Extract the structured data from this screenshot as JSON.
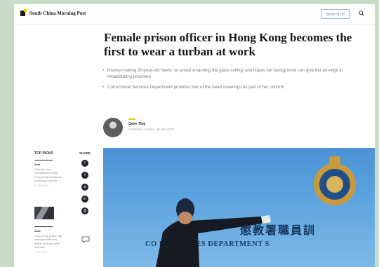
{
  "header": {
    "logo_text": "South China Morning Post",
    "signin_label": "SIGN IN UP",
    "search_icon": "search-icon"
  },
  "article": {
    "headline": "Female prison officer in Hong Kong becomes the first to wear a turban at work",
    "bullets": [
      "History-making 20-year-old Neels ‘so proud smashing the glass ceiling’ and hopes her background can give her an edge in rehabilitating prisoners",
      "Correctional Services Department provides four of the head coverings as part of her uniform"
    ],
    "author_name": "Gene Ting",
    "author_meta": "Published: 2:45am, 30 Mar 2019"
  },
  "sidebar": {
    "top_picks_title": "TOP PICKS",
    "picks": [
      {
        "tag": "Asia",
        "text": "Chinese man cannibalism during Hong Kong Christmas shopping customs",
        "time": "22 Jan 2019"
      },
      {
        "tag": "Asia",
        "text": "Hong Kong police say several rental and hotels as three were arrested",
        "time": "2 Mar 2019"
      }
    ]
  },
  "share": {
    "title": "SHARE",
    "buttons": [
      "f",
      "t",
      "w",
      "in",
      "@"
    ]
  },
  "photo": {
    "wall_chinese": "懲教署職員訓",
    "wall_english": "CO     L SERVICES DEPARTMENT S"
  },
  "colors": {
    "background": "#c9dcc8",
    "accent": "#f3c200",
    "link": "#6f86a8",
    "sky": "#5ea5e0"
  }
}
